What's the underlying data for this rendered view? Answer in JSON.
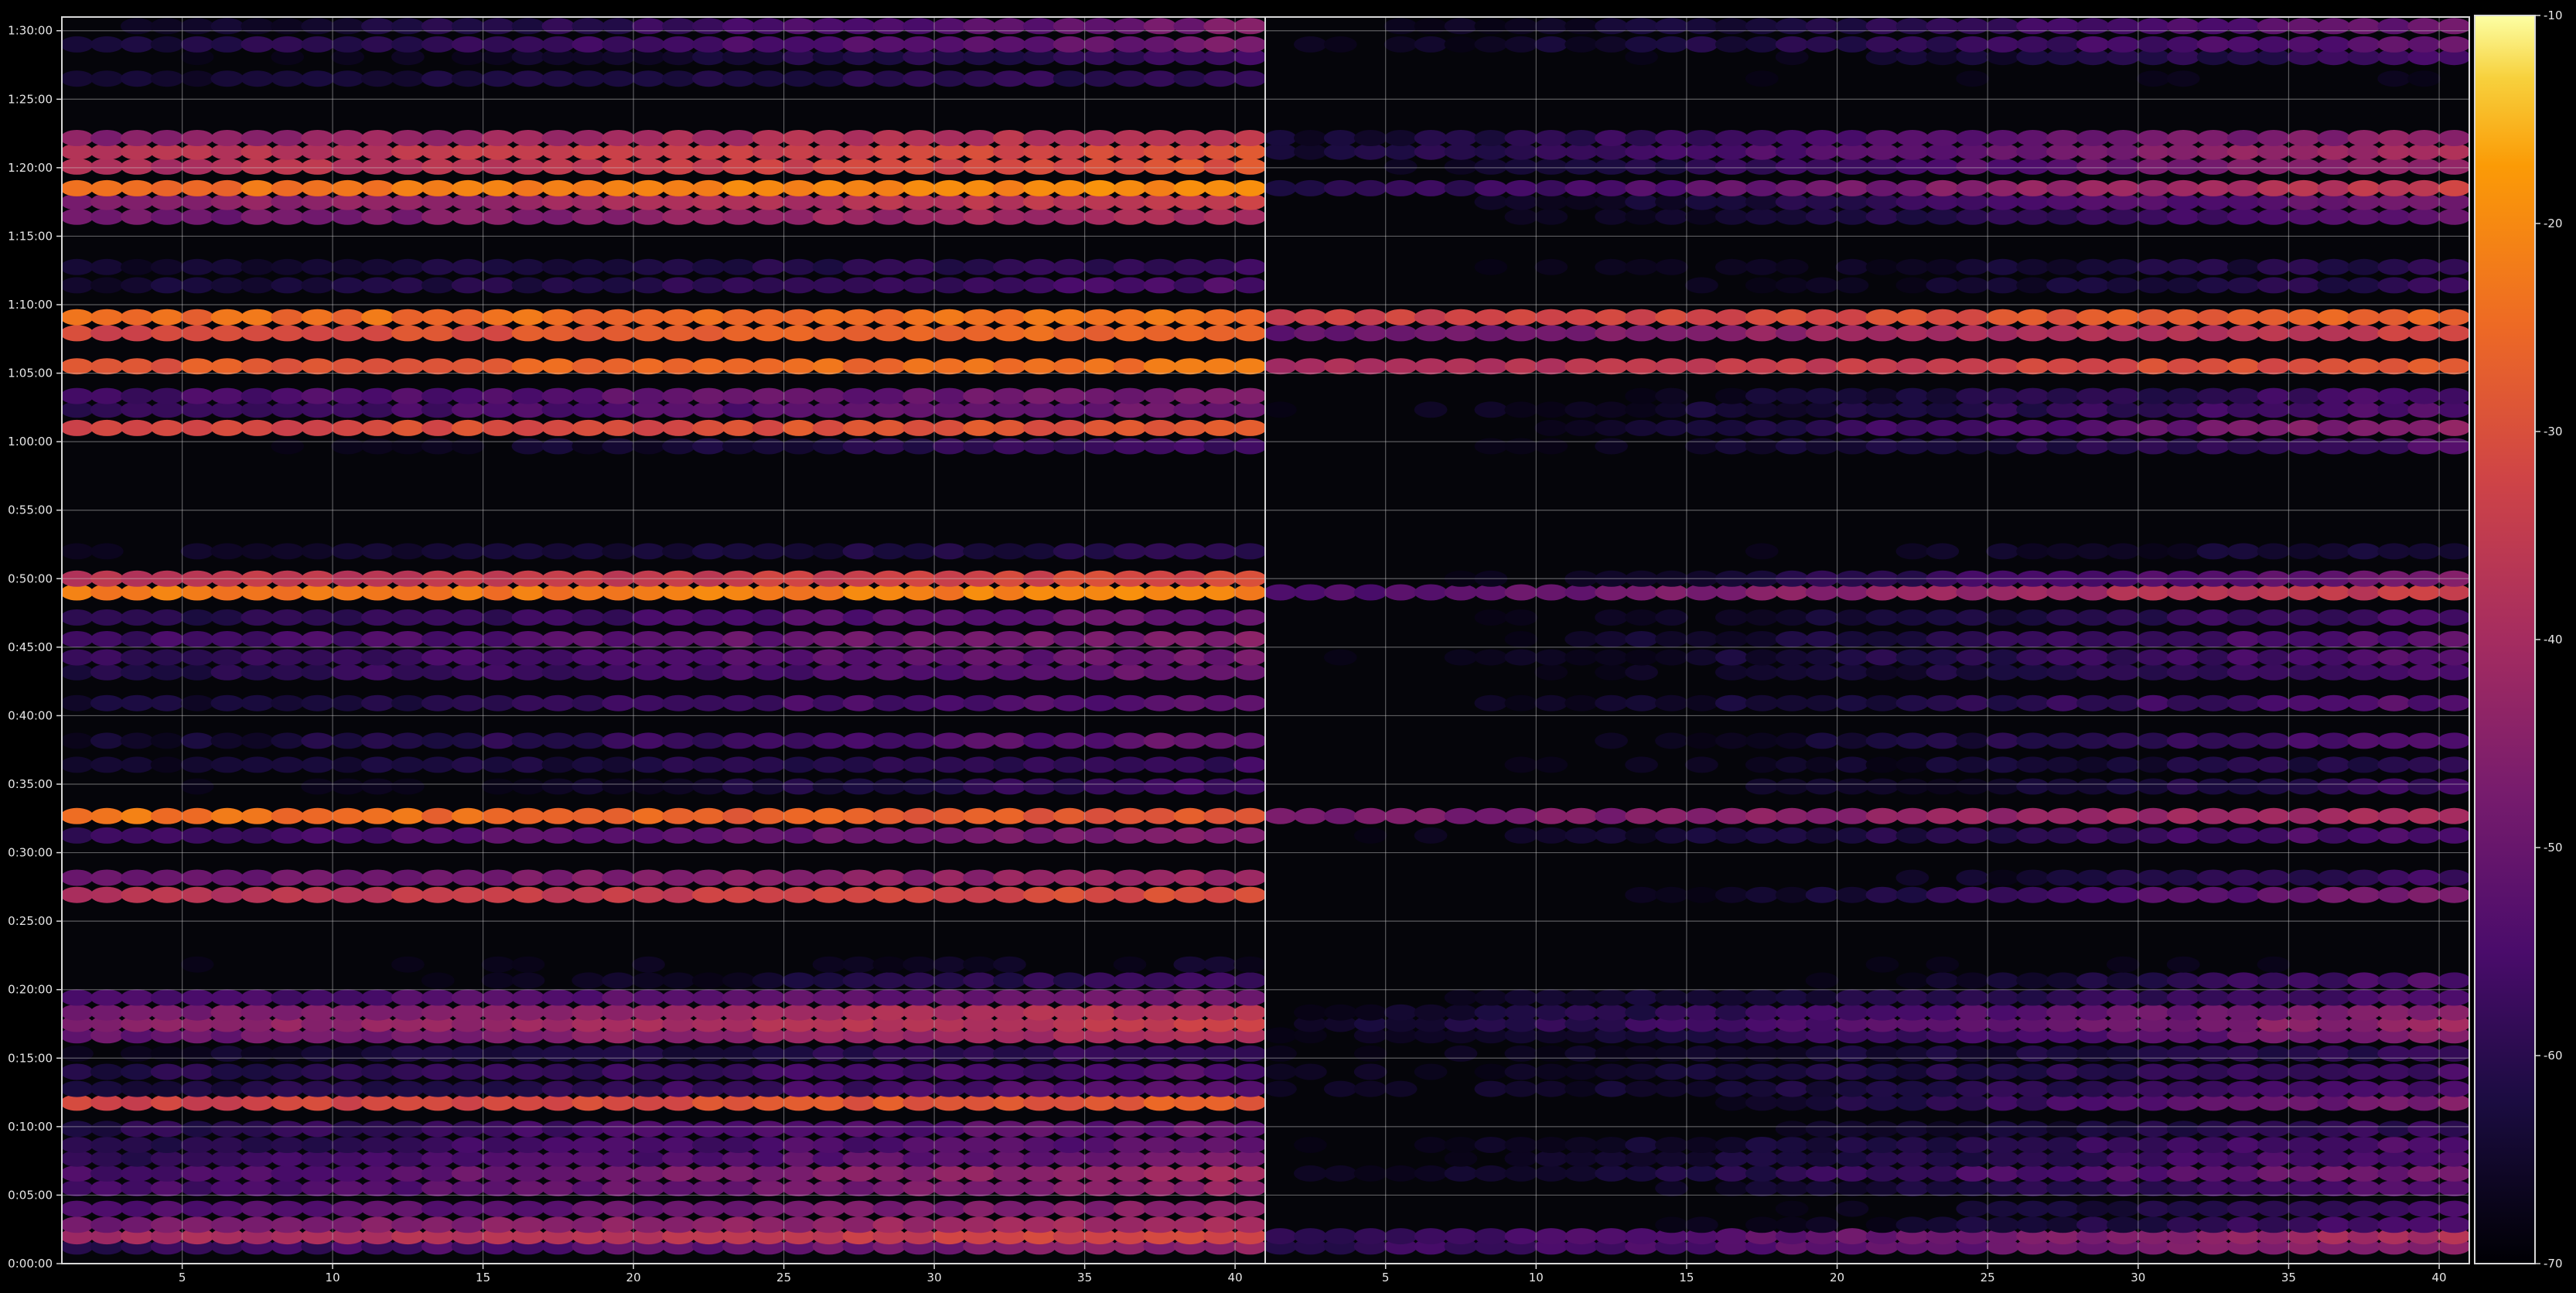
{
  "chart_data": {
    "type": "heatmap",
    "title": "",
    "xlabel": "",
    "ylabel": "",
    "grid": true,
    "panels": [
      {
        "name": "",
        "x_range": [
          1,
          40
        ],
        "x_ticks": [
          "5",
          "10",
          "15",
          "20",
          "25",
          "30",
          "35",
          "40"
        ],
        "x_tick_values": [
          5,
          10,
          15,
          20,
          25,
          30,
          35,
          40
        ]
      },
      {
        "name": "",
        "x_range": [
          1,
          40
        ],
        "x_ticks": [
          "5",
          "10",
          "15",
          "20",
          "25",
          "30",
          "35",
          "40"
        ],
        "x_tick_values": [
          5,
          10,
          15,
          20,
          25,
          30,
          35,
          40
        ]
      }
    ],
    "y_range_seconds": [
      0,
      5460
    ],
    "y_ticks": [
      "0:00:00",
      "0:05:00",
      "0:10:00",
      "0:15:00",
      "0:20:00",
      "0:25:00",
      "0:30:00",
      "0:35:00",
      "0:40:00",
      "0:45:00",
      "0:50:00",
      "0:55:00",
      "1:00:00",
      "1:05:00",
      "1:10:00",
      "1:15:00",
      "1:20:00",
      "1:25:00",
      "1:30:00"
    ],
    "y_tick_values": [
      0,
      300,
      600,
      900,
      1200,
      1500,
      1800,
      2100,
      2400,
      2700,
      3000,
      3300,
      3600,
      3900,
      4200,
      4500,
      4800,
      5100,
      5400
    ],
    "colorbar": {
      "colormap": "inferno",
      "range": [
        -70,
        -10
      ],
      "ticks": [
        "-70",
        "-60",
        "-50",
        "-40",
        "-30",
        "-20",
        "-10"
      ],
      "tick_values": [
        -70,
        -60,
        -50,
        -40,
        -30,
        -20,
        -10
      ]
    },
    "bands": [
      {
        "t": 75,
        "left": -52,
        "right": -52,
        "l_trend": 18,
        "r_trend": 16
      },
      {
        "t": 120,
        "left": -36,
        "right": -50,
        "l_trend": 10,
        "r_trend": 22
      },
      {
        "t": 170,
        "left": -44,
        "right": -66,
        "l_trend": 8,
        "r_trend": 22
      },
      {
        "t": 240,
        "left": -50,
        "right": -68,
        "l_trend": 12,
        "r_trend": 26
      },
      {
        "t": 330,
        "left": -50,
        "right": -64,
        "l_trend": 14,
        "r_trend": 22
      },
      {
        "t": 395,
        "left": -48,
        "right": -58,
        "l_trend": 16,
        "r_trend": 20
      },
      {
        "t": 460,
        "left": -54,
        "right": -62,
        "l_trend": 12,
        "r_trend": 18
      },
      {
        "t": 520,
        "left": -56,
        "right": -62,
        "l_trend": 10,
        "r_trend": 16
      },
      {
        "t": 590,
        "left": -56,
        "right": -66,
        "l_trend": 10,
        "r_trend": 16
      },
      {
        "t": 705,
        "left": -30,
        "right": -62,
        "l_trend": 6,
        "r_trend": 32
      },
      {
        "t": 765,
        "left": -58,
        "right": -62,
        "l_trend": 10,
        "r_trend": 12
      },
      {
        "t": 840,
        "left": -58,
        "right": -62,
        "l_trend": 8,
        "r_trend": 12
      },
      {
        "t": 920,
        "left": -62,
        "right": -64,
        "l_trend": 8,
        "r_trend": 10
      },
      {
        "t": 1000,
        "left": -44,
        "right": -58,
        "l_trend": 14,
        "r_trend": 24
      },
      {
        "t": 1050,
        "left": -40,
        "right": -54,
        "l_trend": 12,
        "r_trend": 24
      },
      {
        "t": 1100,
        "left": -42,
        "right": -56,
        "l_trend": 12,
        "r_trend": 24
      },
      {
        "t": 1165,
        "left": -52,
        "right": -62,
        "l_trend": 8,
        "r_trend": 14
      },
      {
        "t": 1240,
        "left": -66,
        "right": -68,
        "l_trend": 18,
        "r_trend": 28
      },
      {
        "t": 1310,
        "left": -68,
        "right": -70,
        "l_trend": 4,
        "r_trend": 4
      },
      {
        "t": 1615,
        "left": -34,
        "right": -62,
        "l_trend": 8,
        "r_trend": 32
      },
      {
        "t": 1690,
        "left": -46,
        "right": -68,
        "l_trend": 8,
        "r_trend": 24
      },
      {
        "t": 1875,
        "left": -52,
        "right": -62,
        "l_trend": 12,
        "r_trend": 18
      },
      {
        "t": 1960,
        "left": -26,
        "right": -44,
        "l_trend": -6,
        "r_trend": 10
      },
      {
        "t": 2090,
        "left": -64,
        "right": -66,
        "l_trend": 14,
        "r_trend": 16
      },
      {
        "t": 2185,
        "left": -62,
        "right": -66,
        "l_trend": 8,
        "r_trend": 12
      },
      {
        "t": 2290,
        "left": -58,
        "right": -64,
        "l_trend": 16,
        "r_trend": 20
      },
      {
        "t": 2455,
        "left": -58,
        "right": -62,
        "l_trend": 14,
        "r_trend": 18
      },
      {
        "t": 2590,
        "left": -56,
        "right": -64,
        "l_trend": 12,
        "r_trend": 18
      },
      {
        "t": 2655,
        "left": -54,
        "right": -62,
        "l_trend": 10,
        "r_trend": 18
      },
      {
        "t": 2735,
        "left": -52,
        "right": -62,
        "l_trend": 12,
        "r_trend": 18
      },
      {
        "t": 2830,
        "left": -56,
        "right": -64,
        "l_trend": 12,
        "r_trend": 18
      },
      {
        "t": 2940,
        "left": -22,
        "right": -44,
        "l_trend": 2,
        "r_trend": 22
      },
      {
        "t": 3000,
        "left": -34,
        "right": -60,
        "l_trend": 6,
        "r_trend": 26
      },
      {
        "t": 3120,
        "left": -64,
        "right": -68,
        "l_trend": 8,
        "r_trend": 10
      },
      {
        "t": 3580,
        "left": -64,
        "right": -64,
        "l_trend": 16,
        "r_trend": 18
      },
      {
        "t": 3660,
        "left": -30,
        "right": -58,
        "l_trend": 4,
        "r_trend": 30
      },
      {
        "t": 3740,
        "left": -54,
        "right": -62,
        "l_trend": 10,
        "r_trend": 16
      },
      {
        "t": 3800,
        "left": -52,
        "right": -64,
        "l_trend": 10,
        "r_trend": 18
      },
      {
        "t": 3930,
        "left": -26,
        "right": -34,
        "l_trend": 6,
        "r_trend": 12
      },
      {
        "t": 4075,
        "left": -28,
        "right": -42,
        "l_trend": 8,
        "r_trend": 18
      },
      {
        "t": 4145,
        "left": -24,
        "right": -30,
        "l_trend": 2,
        "r_trend": 8
      },
      {
        "t": 4285,
        "left": -60,
        "right": -66,
        "l_trend": 10,
        "r_trend": 14
      },
      {
        "t": 4365,
        "left": -62,
        "right": -66,
        "l_trend": 8,
        "r_trend": 12
      },
      {
        "t": 4585,
        "left": -44,
        "right": -62,
        "l_trend": 12,
        "r_trend": 22
      },
      {
        "t": 4650,
        "left": -40,
        "right": -60,
        "l_trend": 12,
        "r_trend": 24
      },
      {
        "t": 4710,
        "left": -22,
        "right": -48,
        "l_trend": 6,
        "r_trend": 28
      },
      {
        "t": 4805,
        "left": -34,
        "right": -56,
        "l_trend": 10,
        "r_trend": 28
      },
      {
        "t": 4870,
        "left": -34,
        "right": -52,
        "l_trend": 8,
        "r_trend": 24
      },
      {
        "t": 4930,
        "left": -40,
        "right": -54,
        "l_trend": 10,
        "r_trend": 22
      },
      {
        "t": 5190,
        "left": -62,
        "right": -70,
        "l_trend": 6,
        "r_trend": 4
      },
      {
        "t": 5285,
        "left": -64,
        "right": -66,
        "l_trend": 14,
        "r_trend": 18
      },
      {
        "t": 5340,
        "left": -56,
        "right": -60,
        "l_trend": 16,
        "r_trend": 18
      },
      {
        "t": 5420,
        "left": -58,
        "right": -60,
        "l_trend": 22,
        "r_trend": 22
      }
    ]
  }
}
